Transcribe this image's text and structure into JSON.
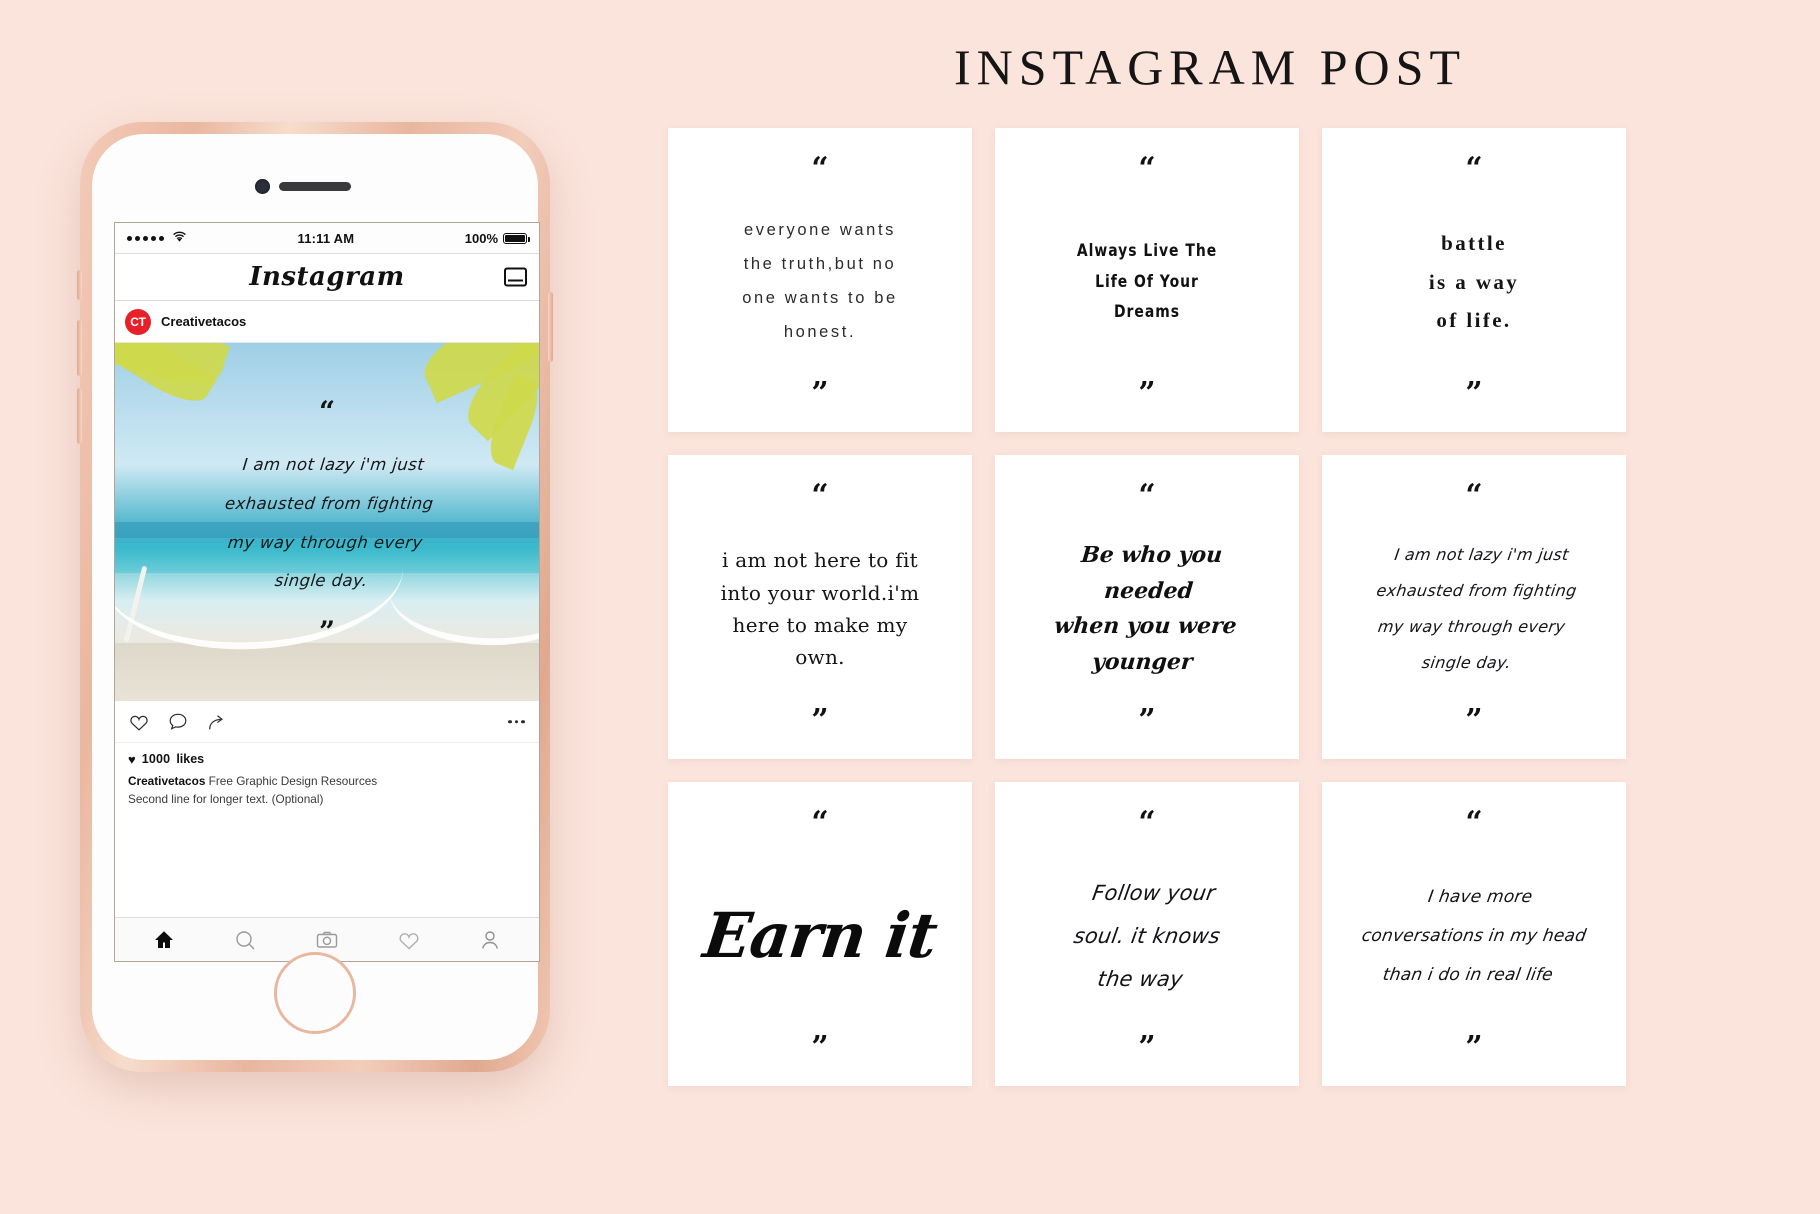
{
  "page": {
    "title": "INSTAGRAM POST",
    "background_color": "#fbe4dc",
    "card_color": "#ffffff",
    "accent_color": "#e8202a"
  },
  "phone": {
    "status_bar": {
      "signal_label": "signal-dots",
      "wifi_label": "wifi-icon",
      "time": "11:11 AM",
      "battery_percent": "100%",
      "battery_icon": "battery-full-icon"
    },
    "nav": {
      "app_logo": "Instagram",
      "inbox_icon": "inbox-icon"
    },
    "post": {
      "avatar_initials": "CT",
      "username": "Creativetacos",
      "photo_alt": "beach-hammock-photo",
      "photo_quote_open": "“",
      "photo_quote_text": "I am not lazy  i'm just\nexhausted from fighting\nmy way through every\nsingle day.",
      "photo_quote_close": "”",
      "actions": {
        "like_icon": "heart-icon",
        "comment_icon": "comment-icon",
        "share_icon": "share-icon",
        "more_icon": "more-dots-icon"
      },
      "likes_heart": "♥",
      "likes_count": "1000",
      "likes_word": "likes",
      "caption_user": "Creativetacos",
      "caption_text": "Free Graphic Design Resources",
      "caption_second_line": "Second line for longer text. (Optional)"
    },
    "tabbar": [
      {
        "name": "home",
        "icon": "home-icon",
        "active": true
      },
      {
        "name": "search",
        "icon": "search-icon",
        "active": false
      },
      {
        "name": "camera",
        "icon": "camera-icon",
        "active": false
      },
      {
        "name": "activity",
        "icon": "heart-icon",
        "active": false
      },
      {
        "name": "profile",
        "icon": "person-icon",
        "active": false
      }
    ]
  },
  "grid": {
    "quote_open": "“",
    "quote_close": "”",
    "cards": [
      {
        "id": "card-1",
        "style": "thin-spaced-sans",
        "text": "everyone wants\nthe truth,but no\none wants to be\nhonest."
      },
      {
        "id": "card-2",
        "style": "condensed-bold-sans",
        "text": "Always Live The\nLife Of Your\nDreams"
      },
      {
        "id": "card-3",
        "style": "spaced-serif",
        "text": "battle\nis a way\nof life."
      },
      {
        "id": "card-4",
        "style": "elegant-serif",
        "text": "i am  not here to fit\ninto your world.i'm\nhere to make my\nown."
      },
      {
        "id": "card-5",
        "style": "bold-italic-script",
        "text": "Be who you\nneeded\nwhen you were\nyounger"
      },
      {
        "id": "card-6",
        "style": "handwritten-script",
        "text": "I am not lazy  i'm just\nexhausted from fighting\nmy way through every\nsingle day."
      },
      {
        "id": "card-7",
        "style": "brush-script-large",
        "text": "Earn it"
      },
      {
        "id": "card-8",
        "style": "script",
        "text": "Follow your\nsoul. it knows\nthe way"
      },
      {
        "id": "card-9",
        "style": "script-small",
        "text": "I have more\nconversations in my head\nthan i do in real life"
      }
    ]
  }
}
